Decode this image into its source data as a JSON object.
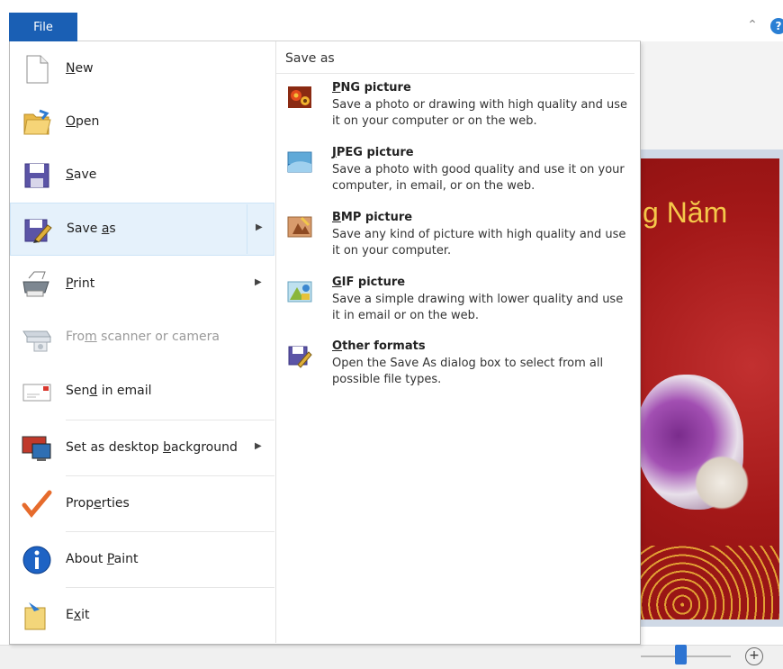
{
  "file_tab": "File",
  "help_icon": "?",
  "ribbon_collapse_icon": "⌃",
  "canvas": {
    "visible_text": "g Năm"
  },
  "status_bar": {
    "zoom_in_icon": "+"
  },
  "menu": {
    "items": [
      {
        "pre": "",
        "key": "N",
        "post": "ew",
        "icon": "new-document-icon",
        "enabled": true
      },
      {
        "pre": "",
        "key": "O",
        "post": "pen",
        "icon": "open-folder-icon",
        "enabled": true
      },
      {
        "pre": "",
        "key": "S",
        "post": "ave",
        "icon": "save-icon",
        "enabled": true
      },
      {
        "pre": "Save ",
        "key": "a",
        "post": "s",
        "icon": "save-as-icon",
        "enabled": true,
        "has_submenu": true,
        "highlighted": true
      },
      {
        "pre": "",
        "key": "P",
        "post": "rint",
        "icon": "printer-icon",
        "enabled": true,
        "has_submenu": true
      },
      {
        "pre": "Fro",
        "key": "m",
        "post": " scanner or camera",
        "icon": "scanner-icon",
        "enabled": false
      },
      {
        "pre": "Sen",
        "key": "d",
        "post": " in email",
        "icon": "email-icon",
        "enabled": true
      },
      {
        "pre": "Set as desktop ",
        "key": "b",
        "post": "ackground",
        "icon": "desktop-background-icon",
        "enabled": true,
        "has_submenu": true
      },
      {
        "pre": "Prop",
        "key": "e",
        "post": "rties",
        "icon": "checkmark-icon",
        "enabled": true
      },
      {
        "pre": "About ",
        "key": "P",
        "post": "aint",
        "icon": "info-icon",
        "enabled": true
      },
      {
        "pre": "E",
        "key": "x",
        "post": "it",
        "icon": "exit-icon",
        "enabled": true
      }
    ],
    "submenu_arrow": "▶"
  },
  "save_as": {
    "header": "Save as",
    "options": [
      {
        "key": "P",
        "rest": "NG picture",
        "desc": "Save a photo or drawing with high quality and use it on your computer or on the web.",
        "icon": "png-picture-icon"
      },
      {
        "key": "J",
        "rest": "PEG picture",
        "desc": "Save a photo with good quality and use it on your computer, in email, or on the web.",
        "icon": "jpeg-picture-icon"
      },
      {
        "key": "B",
        "rest": "MP picture",
        "desc": "Save any kind of picture with high quality and use it on your computer.",
        "icon": "bmp-picture-icon"
      },
      {
        "key": "G",
        "rest": "IF picture",
        "desc": "Save a simple drawing with lower quality and use it in email or on the web.",
        "icon": "gif-picture-icon"
      },
      {
        "key": "O",
        "rest": "ther formats",
        "desc": "Open the Save As dialog box to select from all possible file types.",
        "icon": "other-formats-icon"
      }
    ]
  },
  "colors": {
    "file_tab": "#1a5fb4",
    "hover": "#e5f1fb",
    "disabled_text": "#9a9a9a"
  }
}
